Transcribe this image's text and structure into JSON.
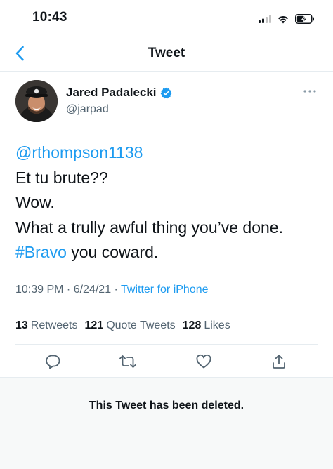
{
  "status_bar": {
    "time": "10:43",
    "icons": [
      "signal-icon",
      "wifi-icon",
      "battery-charging-icon"
    ]
  },
  "nav": {
    "title": "Tweet",
    "back_icon": "chevron-left-icon"
  },
  "author": {
    "display_name": "Jared Padalecki",
    "username": "@jarpad",
    "verified": true
  },
  "tweet": {
    "mention": "@rthompson1138",
    "line2": "Et tu brute??",
    "line3": "Wow.",
    "line4": "What a trully awful thing you’ve done.",
    "hashtag": "#Bravo",
    "line5_rest": " you coward."
  },
  "meta": {
    "time_date": "10:39 PM · 6/24/21 · ",
    "source": "Twitter for iPhone"
  },
  "stats": {
    "retweets_count": "13",
    "retweets_label": "Retweets",
    "quotes_count": "121",
    "quotes_label": "Quote Tweets",
    "likes_count": "128",
    "likes_label": "Likes"
  },
  "actions": [
    "reply-icon",
    "retweet-icon",
    "like-icon",
    "share-icon"
  ],
  "deleted_notice": "This Tweet has been deleted.",
  "colors": {
    "accent": "#1d9bf0",
    "secondary_text": "#536471",
    "divider": "#e6ecf0",
    "panel": "#f7f9f9"
  }
}
